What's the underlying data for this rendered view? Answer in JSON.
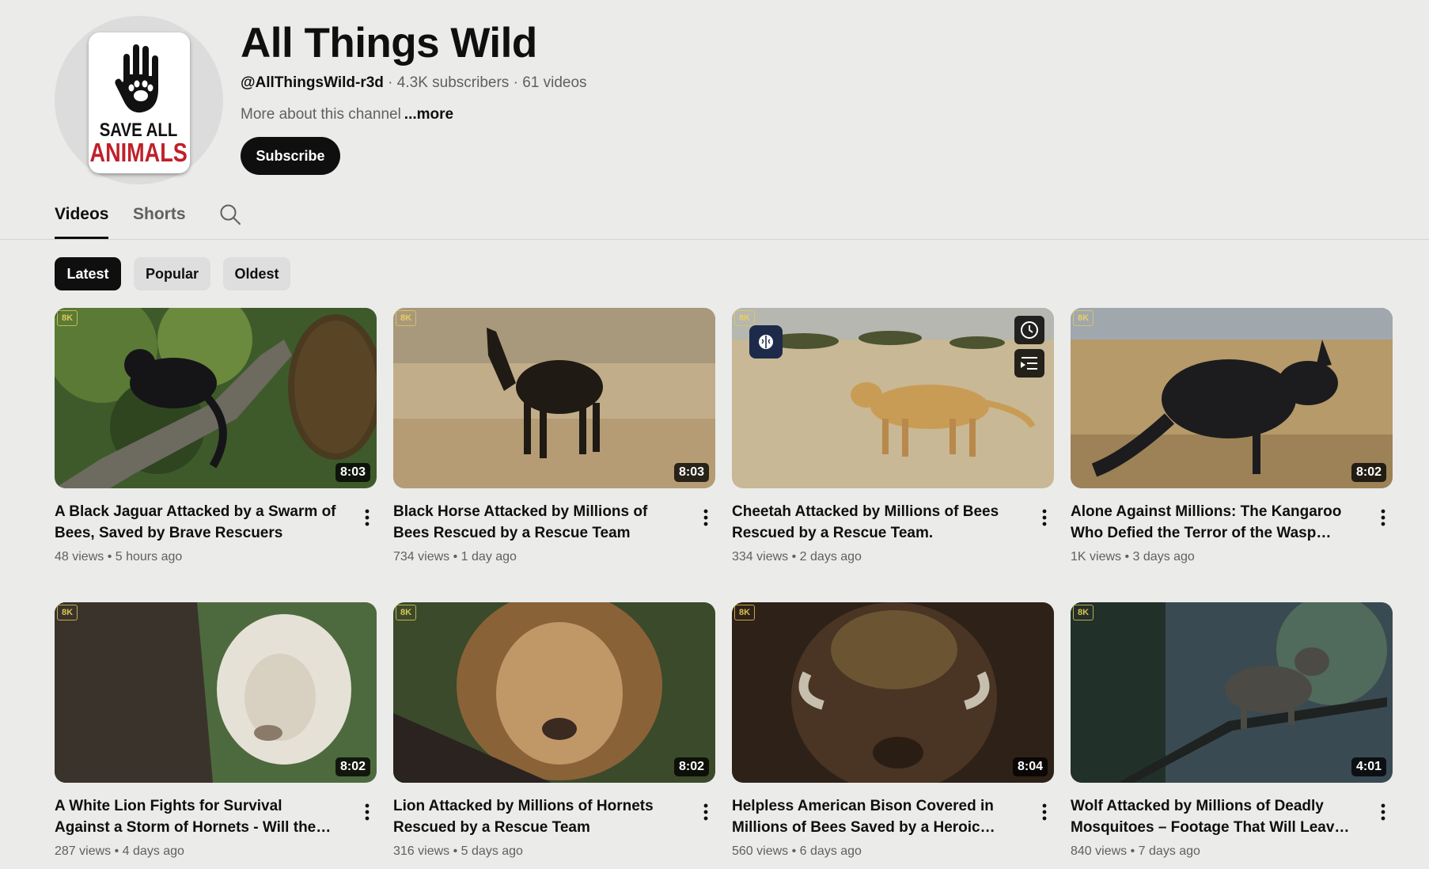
{
  "channel": {
    "name": "All Things Wild",
    "handle": "@AllThingsWild-r3d",
    "subscribers": "4.3K subscribers",
    "video_count": "61 videos",
    "separator": " · ",
    "about": "More about this channel",
    "more_label": "...more",
    "subscribe_label": "Subscribe",
    "avatar_text_line1": "SAVE ALL",
    "avatar_text_line2": "ANIMALS"
  },
  "tabs": [
    {
      "label": "Videos",
      "active": true
    },
    {
      "label": "Shorts",
      "active": false
    }
  ],
  "chips": [
    {
      "label": "Latest",
      "active": true
    },
    {
      "label": "Popular",
      "active": false
    },
    {
      "label": "Oldest",
      "active": false
    }
  ],
  "badge_label": "8K",
  "videos": [
    {
      "title": "A Black Jaguar Attacked by a Swarm of Bees, Saved by Brave Rescuers",
      "views": "48 views",
      "age": "5 hours ago",
      "duration": "8:03"
    },
    {
      "title": "Black Horse Attacked by Millions of Bees Rescued by a Rescue Team",
      "views": "734 views",
      "age": "1 day ago",
      "duration": "8:03"
    },
    {
      "title": "Cheetah Attacked by Millions of Bees Rescued by a Rescue Team.",
      "views": "334 views",
      "age": "2 days ago",
      "duration": ""
    },
    {
      "title": "Alone Against Millions: The Kangaroo Who Defied the Terror of the Wasp Storm!",
      "views": "1K views",
      "age": "3 days ago",
      "duration": "8:02"
    },
    {
      "title": "A White Lion Fights for Survival Against a Storm of Hornets - Will the Rescue Team…",
      "views": "287 views",
      "age": "4 days ago",
      "duration": "8:02"
    },
    {
      "title": "Lion Attacked by Millions of Hornets Rescued by a Rescue Team",
      "views": "316 views",
      "age": "5 days ago",
      "duration": "8:02"
    },
    {
      "title": "Helpless American Bison Covered in Millions of Bees Saved by a Heroic Rescue Team!",
      "views": "560 views",
      "age": "6 days ago",
      "duration": "8:04"
    },
    {
      "title": "Wolf Attacked by Millions of Deadly Mosquitoes – Footage That Will Leave You…",
      "views": "840 views",
      "age": "7 days ago",
      "duration": "4:01"
    }
  ],
  "meta_separator": "•"
}
